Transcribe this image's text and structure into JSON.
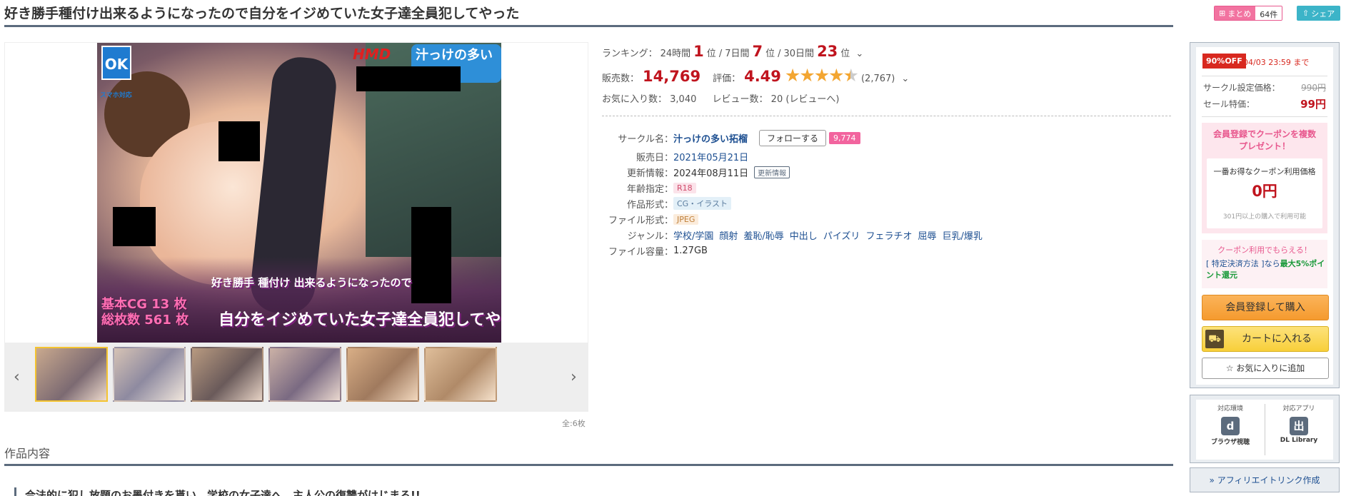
{
  "title": "好き勝手種付け出来るようになったので自分をイジめていた女子達全員犯してやった",
  "header": {
    "matome_label": "まとめ",
    "matome_count": "64件",
    "share_label": "シェア"
  },
  "gallery": {
    "badge_ok": "OK",
    "badge_sub": "スマホ対応",
    "logo1": "HMD",
    "logo2": "汁っけの多い拓榴",
    "cg_count_line1": "基本CG 13 枚",
    "cg_count_line2": "総枚数 561 枚",
    "banner_small": "好き勝手 種付け 出来るようになったので",
    "banner_big": "自分をイジめていた女子達全員犯してやった",
    "count_label": "全:6枚"
  },
  "ranking": {
    "label": "ランキング：",
    "items": [
      {
        "period": "24時間",
        "rank": "1",
        "unit": "位"
      },
      {
        "period": "7日間",
        "rank": "7",
        "unit": "位"
      },
      {
        "period": "30日間",
        "rank": "23",
        "unit": "位"
      }
    ],
    "sep": "/"
  },
  "stats": {
    "sales_label": "販売数：",
    "sales_value": "14,769",
    "rating_label": "評価：",
    "rating_value": "4.49",
    "rating_stars": "★★★★",
    "rating_half": "★",
    "rating_count": "(2,767)",
    "fav_label": "お気に入り数：",
    "fav_value": "3,040",
    "review_label": "レビュー数：",
    "review_value": "20",
    "review_link": "(レビューへ)"
  },
  "meta": {
    "circle_label": "サークル名",
    "circle_value": "汁っけの多い拓榴",
    "follow_label": "フォローする",
    "follow_count": "9,774",
    "release_label": "販売日",
    "release_value": "2021年05月21日",
    "update_label": "更新情報",
    "update_value": "2024年08月11日",
    "update_tag": "更新情報",
    "age_label": "年齢指定",
    "age_value": "R18",
    "format_label": "作品形式",
    "format_value": "CG・イラスト",
    "file_label": "ファイル形式",
    "file_value": "JPEG",
    "genre_label": "ジャンル",
    "genres": [
      "学校/学園",
      "顔射",
      "羞恥/恥辱",
      "中出し",
      "パイズリ",
      "フェラチオ",
      "屈辱",
      "巨乳/爆乳"
    ],
    "size_label": "ファイル容量",
    "size_value": "1.27GB",
    "colon": "："
  },
  "sidebar": {
    "off_badge": "90%OFF",
    "off_date": "04/03 23:59 まで",
    "list_price_label": "サークル設定価格：",
    "list_price_value": "990円",
    "sale_price_label": "セール特価：",
    "sale_price_value": "99円",
    "coupon_title_1": "会員登録でクーポンを複数",
    "coupon_title_2": "プレゼント！",
    "coupon_best_label": "一番お得なクーポン利用価格",
    "coupon_price": "0円",
    "coupon_note": "301円以上の購入で利用可能",
    "coupon2_title": "クーポン利用でもらえる！",
    "coupon2_text_pre": "[ 特定決済方法 ]なら",
    "coupon2_text_strong": "最大5%ポイント還元",
    "buy_button": "会員登録して購入",
    "cart_button": "カートに入れる",
    "fav_button": "お気に入りに追加"
  },
  "environment": {
    "env_label": "対応環境",
    "env_name": "ブラウザ視聴",
    "app_label": "対応アプリ",
    "app_name": "DL Library"
  },
  "affiliate": "アフィリエイトリンク作成",
  "section": {
    "heading": "作品内容",
    "intro": "合法的に犯し放題のお墨付きを貰い、学校の女子達へ、主人公の復讐がはじまる!!"
  },
  "colors": {
    "accent_red": "#c0141e",
    "pink": "#f2649e",
    "link_blue": "#1d4f91",
    "bar_slate": "#5c6b7d"
  }
}
